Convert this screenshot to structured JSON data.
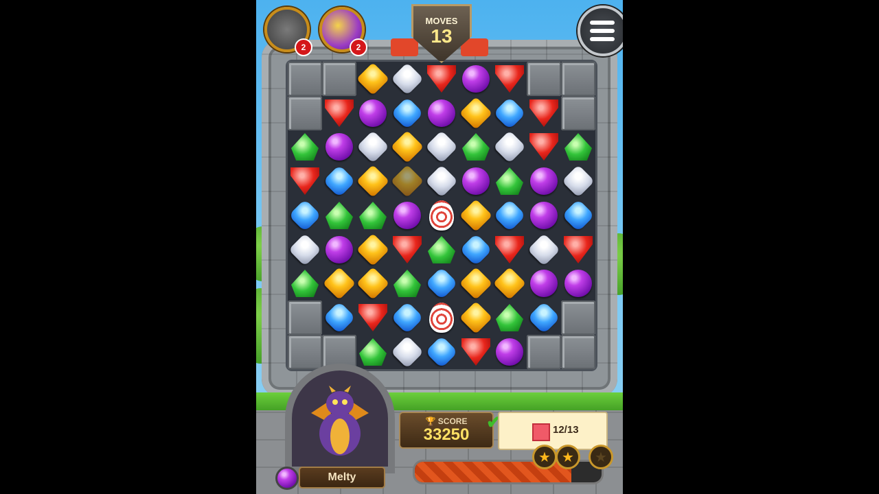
{
  "hud": {
    "boosters": [
      {
        "name": "hammer",
        "count": "2"
      },
      {
        "name": "star-swap",
        "count": "2"
      }
    ],
    "moves_label": "MOVES",
    "moves_value": "13",
    "menu_icon": "menu-icon"
  },
  "board": {
    "rows": [
      [
        "block",
        "block",
        "orange",
        "white",
        "red",
        "purple",
        "red",
        "block",
        "block"
      ],
      [
        "block",
        "red",
        "purple",
        "blue",
        "purple",
        "orange",
        "blue",
        "red",
        "block"
      ],
      [
        "green",
        "purple",
        "white",
        "orange",
        "white",
        "green",
        "white",
        "red",
        "green"
      ],
      [
        "red",
        "blue",
        "orange",
        "orange-ghost",
        "white",
        "purple",
        "green",
        "purple",
        "white"
      ],
      [
        "blue",
        "green",
        "green",
        "purple",
        "egg",
        "orange",
        "blue",
        "purple",
        "blue"
      ],
      [
        "white",
        "purple",
        "orange",
        "red",
        "green",
        "blue",
        "red",
        "white",
        "red"
      ],
      [
        "green",
        "orange",
        "orange",
        "green",
        "blue",
        "orange",
        "orange",
        "purple",
        "purple"
      ],
      [
        "block",
        "blue",
        "red",
        "blue",
        "egg",
        "orange",
        "green",
        "blue",
        "block"
      ],
      [
        "block",
        "block",
        "green",
        "white",
        "blue",
        "red",
        "purple",
        "block",
        "block"
      ]
    ]
  },
  "character": {
    "name": "Melty"
  },
  "score": {
    "label": "SCORE",
    "value": "33250"
  },
  "goal": {
    "text": "12/13",
    "jelly_color": "#f05a68"
  },
  "progress": {
    "fill_fraction": 0.84
  },
  "stars": [
    {
      "earned": true
    },
    {
      "earned": true
    },
    {
      "earned": false
    }
  ]
}
